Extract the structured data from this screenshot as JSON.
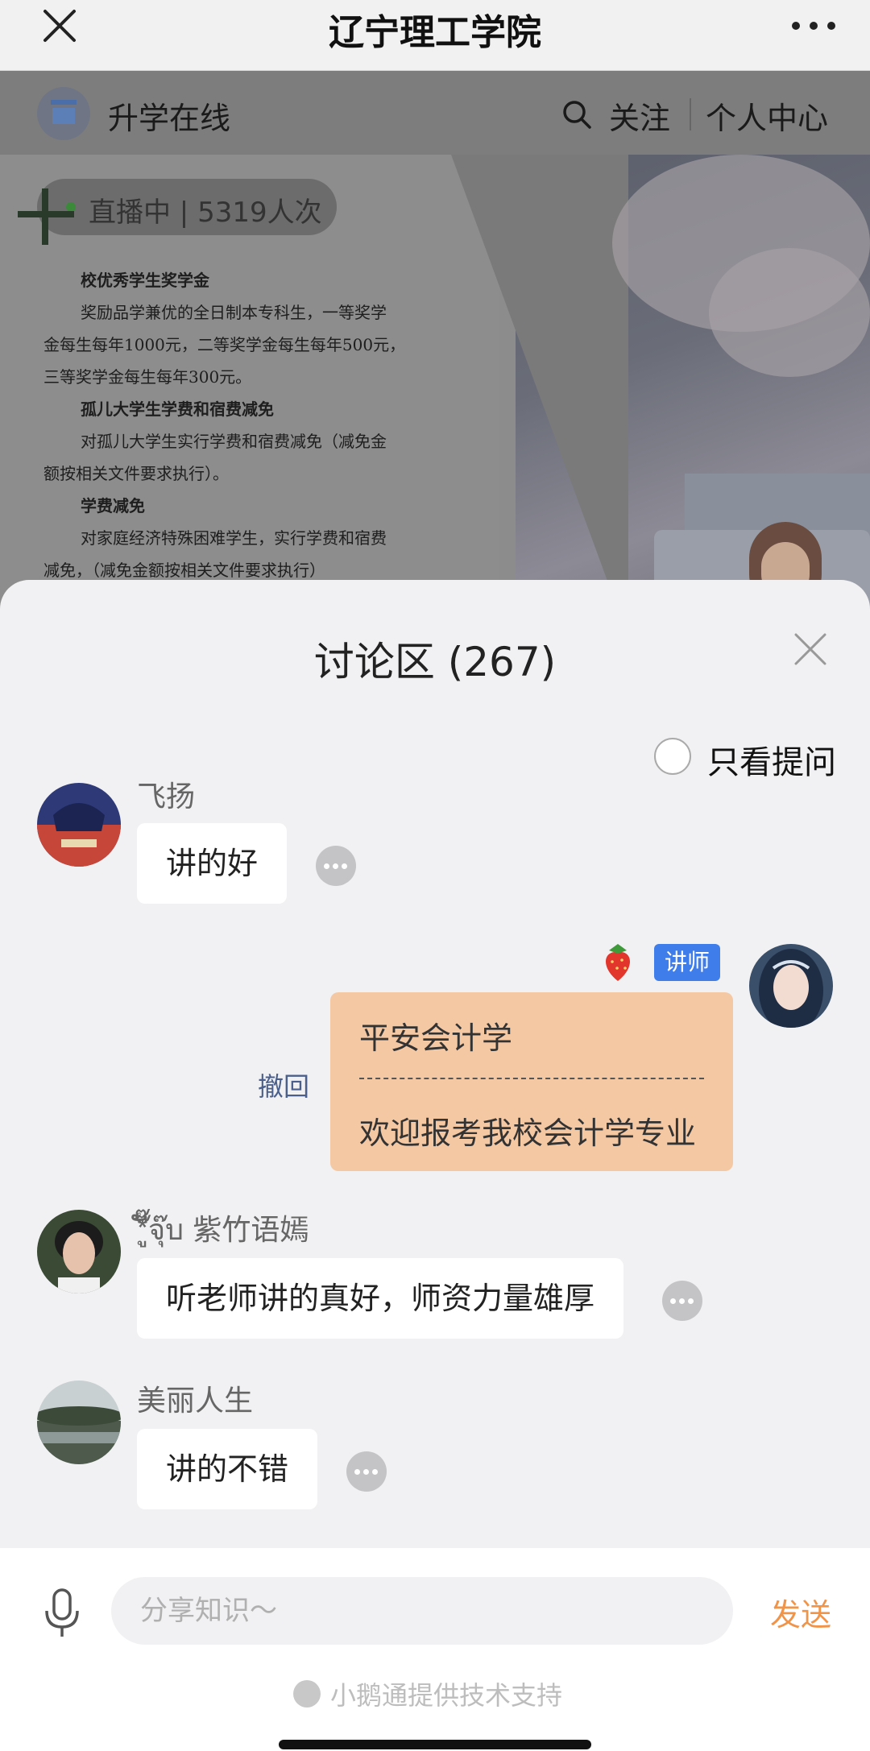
{
  "nav": {
    "title": "辽宁理工学院"
  },
  "background": {
    "shop_name": "升学在线",
    "follow_label": "关注",
    "personal_center_label": "个人中心",
    "live_status": "直播中 | 5319人次",
    "slide_text": [
      {
        "kind": "h",
        "text": "校优秀学生奖学金"
      },
      {
        "kind": "p",
        "text": "奖励品学兼优的全日制本专科生，一等奖学"
      },
      {
        "kind": "p2",
        "text": "金每生每年1000元，二等奖学金每生每年500元，"
      },
      {
        "kind": "p2",
        "text": "三等奖学金每生每年300元。"
      },
      {
        "kind": "h",
        "text": "孤儿大学生学费和宿费减免"
      },
      {
        "kind": "p",
        "text": "对孤儿大学生实行学费和宿费减免（减免金"
      },
      {
        "kind": "p2",
        "text": "额按相关文件要求执行）。"
      },
      {
        "kind": "h",
        "text": "学费减免"
      },
      {
        "kind": "p",
        "text": "对家庭经济特殊困难学生，实行学费和宿费"
      },
      {
        "kind": "p2",
        "text": "减免，（减免金额按相关文件要求执行）"
      }
    ]
  },
  "discussion": {
    "title": "讨论区 (267)",
    "questions_only_label": "只看提问",
    "messages": [
      {
        "user": "飞扬",
        "text": "讲的好"
      },
      {
        "user": "",
        "badge": "讲师",
        "line1": "平安会计学",
        "divider": "-----------------------------",
        "line2": "欢迎报考我校会计学专业",
        "recall_label": "撤回"
      },
      {
        "user": "*ู๊ັ๊จุ๊บ 紫竹语嫣",
        "text": "听老师讲的真好，师资力量雄厚"
      },
      {
        "user": "美丽人生",
        "text": "讲的不错"
      }
    ]
  },
  "input_bar": {
    "placeholder": "分享知识～",
    "send_label": "发送",
    "powered_by": "小鹅通提供技术支持"
  },
  "colors": {
    "accent": "#f0944a",
    "lecturer_badge": "#3f7dea",
    "lecturer_bubble": "#f5c8a4",
    "recall": "#4a5f8c"
  }
}
